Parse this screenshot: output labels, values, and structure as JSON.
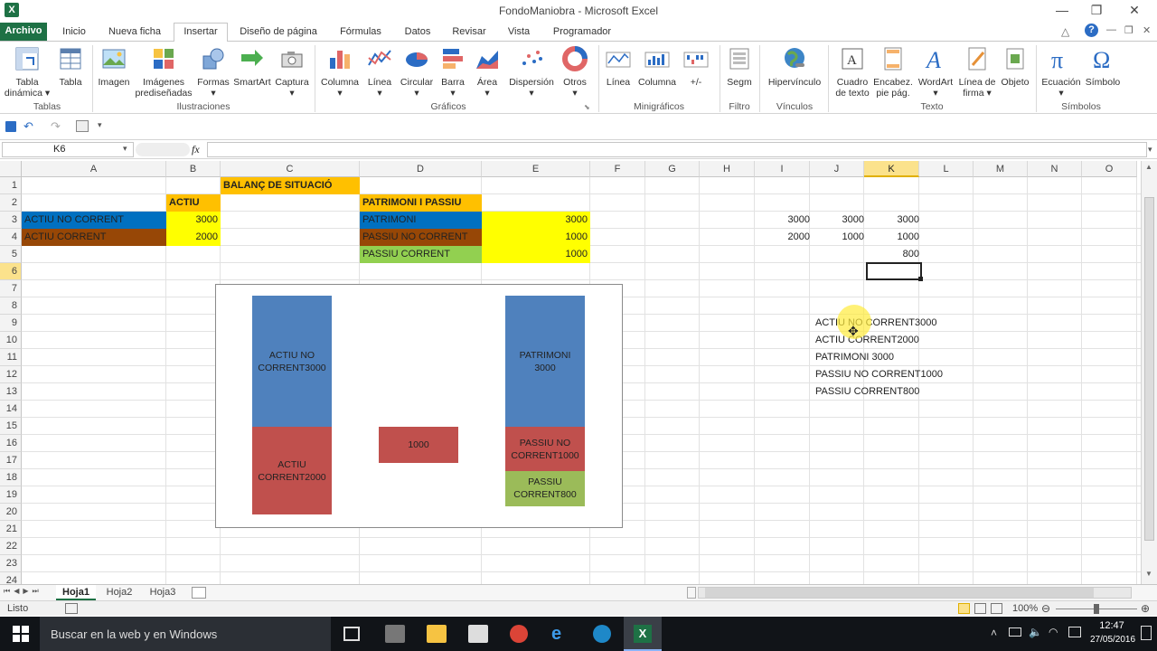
{
  "window": {
    "title": "FondoManiobra - Microsoft Excel",
    "app_icon": "X"
  },
  "tabs": [
    "Archivo",
    "Inicio",
    "Nueva ficha",
    "Insertar",
    "Diseño de página",
    "Fórmulas",
    "Datos",
    "Revisar",
    "Vista",
    "Programador"
  ],
  "ribbon": {
    "buttons": [
      {
        "label": "Tabla",
        "label2": "dinámica ▾"
      },
      {
        "label": "Tabla",
        "label2": ""
      },
      {
        "label": "Imagen",
        "label2": ""
      },
      {
        "label": "Imágenes",
        "label2": "prediseñadas"
      },
      {
        "label": "Formas",
        "label2": "▾"
      },
      {
        "label": "SmartArt",
        "label2": ""
      },
      {
        "label": "Captura",
        "label2": "▾"
      },
      {
        "label": "Columna",
        "label2": "▾"
      },
      {
        "label": "Línea",
        "label2": "▾"
      },
      {
        "label": "Circular",
        "label2": "▾"
      },
      {
        "label": "Barra",
        "label2": "▾"
      },
      {
        "label": "Área",
        "label2": "▾"
      },
      {
        "label": "Dispersión",
        "label2": "▾"
      },
      {
        "label": "Otros",
        "label2": "▾"
      },
      {
        "label": "Línea",
        "label2": ""
      },
      {
        "label": "Columna",
        "label2": ""
      },
      {
        "label": "+/-",
        "label2": ""
      },
      {
        "label": "Segm",
        "label2": ""
      },
      {
        "label": "Hipervínculo",
        "label2": ""
      },
      {
        "label": "Cuadro",
        "label2": "de texto"
      },
      {
        "label": "Encabez.",
        "label2": "pie pág."
      },
      {
        "label": "WordArt",
        "label2": "▾"
      },
      {
        "label": "Línea de",
        "label2": "firma ▾"
      },
      {
        "label": "Objeto",
        "label2": ""
      },
      {
        "label": "Ecuación",
        "label2": "▾"
      },
      {
        "label": "Símbolo",
        "label2": ""
      }
    ],
    "groups": [
      "Tablas",
      "Ilustraciones",
      "Gráficos",
      "Minigráficos",
      "Filtro",
      "Vínculos",
      "Texto",
      "Símbolos"
    ]
  },
  "formula_bar": {
    "name_box": "K6",
    "fx": "fx",
    "value": ""
  },
  "columns": [
    "A",
    "B",
    "C",
    "D",
    "E",
    "F",
    "G",
    "H",
    "I",
    "J",
    "K",
    "L",
    "M",
    "N",
    "O"
  ],
  "rows": [
    "1",
    "2",
    "3",
    "4",
    "5",
    "6",
    "7",
    "8",
    "9",
    "10",
    "11",
    "12",
    "13",
    "14",
    "15",
    "16",
    "17",
    "18",
    "19",
    "20",
    "21",
    "22",
    "23",
    "24"
  ],
  "cells": {
    "c1": "BALANÇ DE SITUACIÓ",
    "b2": "ACTIU",
    "d2": "PATRIMONI I PASSIU",
    "a3": "ACTIU NO CORRENT",
    "b3": "3000",
    "d3": "PATRIMONI",
    "e3": "3000",
    "a4": "ACTIU CORRENT",
    "b4": "2000",
    "d4": "PASSIU NO CORRENT",
    "e4": "1000",
    "d5": "PASSIU CORRENT",
    "e5": "1000",
    "i3": "3000",
    "j3": "3000",
    "k3": "3000",
    "i4": "2000",
    "j4": "1000",
    "k4": "1000",
    "k5": "800",
    "j9": "ACTIU NO CORRENT3000",
    "j10": "ACTIU CORRENT2000",
    "j11": "PATRIMONI 3000",
    "j12": "PASSIU NO CORRENT1000",
    "j13": "PASSIU CORRENT800"
  },
  "colors": {
    "orange": "#ffc000",
    "yellow": "#ffff00",
    "blue": "#0070c0",
    "brown": "#974706",
    "green": "#92d050",
    "bar_blue": "#4f81bd",
    "bar_red": "#c0504d",
    "bar_green": "#9bbb59"
  },
  "chart_data": {
    "type": "bar",
    "stacked": true,
    "categories": [
      "",
      "",
      ""
    ],
    "series": [
      {
        "values": [
          3000,
          0,
          3000
        ],
        "labels": [
          "ACTIU NO CORRENT3000",
          "",
          "PATRIMONI 3000"
        ],
        "color": "#4f81bd"
      },
      {
        "values": [
          2000,
          1000,
          1000
        ],
        "labels": [
          "ACTIU CORRENT2000",
          "1000",
          "PASSIU NO CORRENT1000"
        ],
        "color": "#c0504d"
      },
      {
        "values": [
          0,
          0,
          800
        ],
        "labels": [
          "",
          "",
          "PASSIU CORRENT800"
        ],
        "color": "#9bbb59"
      }
    ],
    "ylim": [
      0,
      5200
    ],
    "grid": false,
    "legend": "none"
  },
  "sheet_tabs": [
    "Hoja1",
    "Hoja2",
    "Hoja3"
  ],
  "status": {
    "ready": "Listo",
    "zoom": "100%"
  },
  "taskbar": {
    "search": "Buscar en la web y en Windows",
    "time": "12:47",
    "date": "27/05/2016"
  }
}
